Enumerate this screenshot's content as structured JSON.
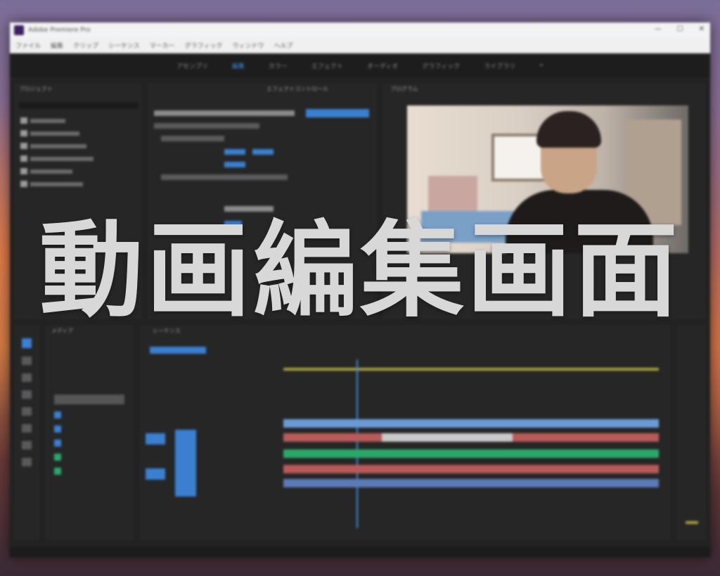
{
  "overlay": {
    "title": "動画編集画面"
  },
  "window": {
    "title": "Adobe Premiere Pro",
    "buttons": [
      "—",
      "☐",
      "✕"
    ]
  },
  "menu": {
    "items": [
      "ファイル",
      "編集",
      "クリップ",
      "シーケンス",
      "マーカー",
      "グラフィック",
      "ウィンドウ",
      "ヘルプ"
    ]
  },
  "workspaces": {
    "items": [
      "アセンブリ",
      "編集",
      "カラー",
      "エフェクト",
      "オーディオ",
      "グラフィック",
      "ライブラリ",
      "»"
    ],
    "active_index": 1
  },
  "panels": {
    "project_tab": "プロジェクト",
    "effects_tab": "エフェクトコントロール",
    "program_tab": "プログラム",
    "timeline_tab": "シーケンス",
    "media_tab": "メディア"
  },
  "colors": {
    "accent": "#3a8fe0",
    "video_clip": "#b85a5a",
    "audio_clip": "#2aa86a",
    "sequence_bar": "#6a9ad6"
  }
}
